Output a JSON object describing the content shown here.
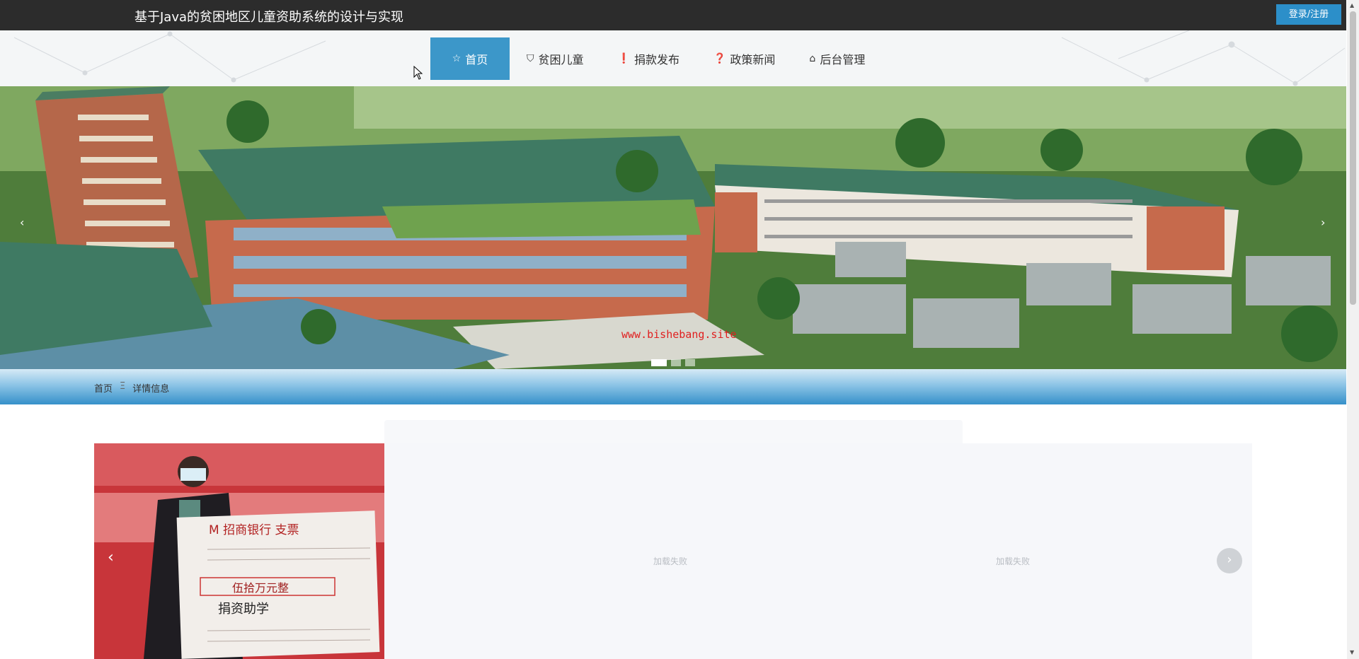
{
  "header": {
    "site_title": "基于Java的贫困地区儿童资助系统的设计与实现",
    "login_label": "登录/注册"
  },
  "nav": {
    "items": [
      {
        "label": "首页",
        "icon": "star-icon",
        "active": true
      },
      {
        "label": "贫困儿童",
        "icon": "shopping-bag-icon",
        "active": false
      },
      {
        "label": "捐款发布",
        "icon": "exclamation-circle-icon",
        "active": false
      },
      {
        "label": "政策新闻",
        "icon": "question-circle-icon",
        "active": false
      },
      {
        "label": "后台管理",
        "icon": "briefcase-icon",
        "active": false
      }
    ]
  },
  "banner": {
    "watermark": "www.bishebang.site",
    "slide_count": 3,
    "active_slide": 1
  },
  "breadcrumb": {
    "home": "首页",
    "separator": "Ξ",
    "current": "详情信息"
  },
  "detail": {
    "image_load_failed_1": "加载失败",
    "image_load_failed_2": "加载失败"
  },
  "colors": {
    "topbar": "#2c2c2c",
    "accent": "#3c97c9",
    "login": "#2c8fc9"
  }
}
